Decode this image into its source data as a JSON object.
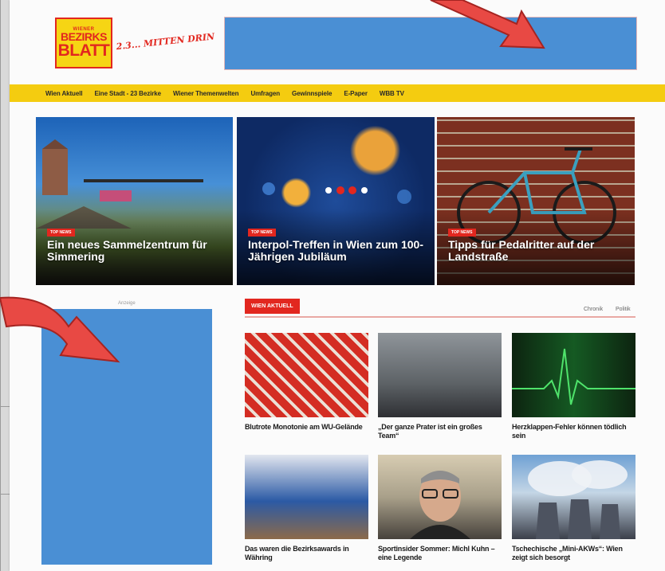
{
  "header": {
    "logo": {
      "line1": "WIENER",
      "line2": "BEZIRKS",
      "line3": "BLATT"
    },
    "tagline": "2.3... MITTEN DRIN"
  },
  "nav": {
    "items": [
      "Wien Aktuell",
      "Eine Stadt - 23 Bezirke",
      "Wiener Themenwelten",
      "Umfragen",
      "Gewinnspiele",
      "E-Paper",
      "WBB TV"
    ]
  },
  "hero": [
    {
      "badge": "TOP NEWS",
      "title": "Ein neues Sammelzentrum für Simmering"
    },
    {
      "badge": "TOP NEWS",
      "title": "Interpol-Treffen in Wien zum 100-Jährigen Jubiläum"
    },
    {
      "badge": "TOP NEWS",
      "title": "Tipps für Pedalritter auf der Landstraße"
    }
  ],
  "ad": {
    "label": "Anzeige"
  },
  "section": {
    "tag": "WIEN AKTUELL",
    "links": [
      "Chronik",
      "Politik"
    ]
  },
  "cards": [
    {
      "caption": "Blutrote Monotonie am WU-Gelände"
    },
    {
      "caption": "„Der ganze Prater ist ein großes Team“"
    },
    {
      "caption": "Herzklappen-Fehler können tödlich sein"
    },
    {
      "caption": "Das waren die Bezirksawards in Währing"
    },
    {
      "caption": "Sportinsider Sommer: Michl Kuhn – eine Legende"
    },
    {
      "caption": "Tschechische „Mini-AKWs“: Wien zeigt sich besorgt"
    }
  ],
  "colors": {
    "accent": "#e2271f",
    "nav": "#f4cc10",
    "adPlaceholder": "#4a8fd4"
  }
}
